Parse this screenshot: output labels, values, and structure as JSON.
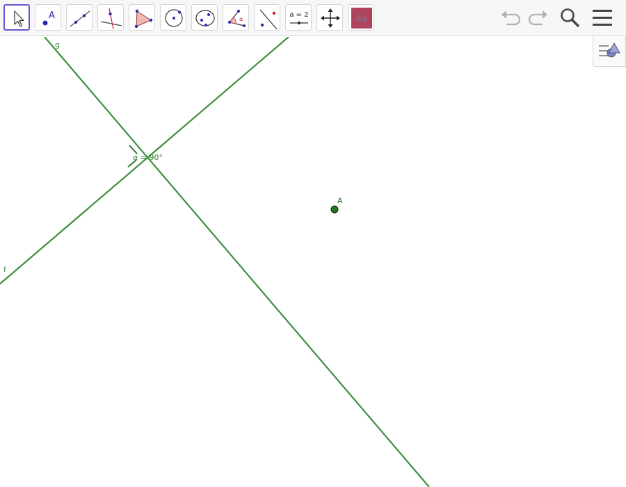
{
  "toolbar": {
    "tools": [
      {
        "name": "move-tool"
      },
      {
        "name": "point-tool",
        "label": "A"
      },
      {
        "name": "line-tool"
      },
      {
        "name": "perpendicular-line-tool"
      },
      {
        "name": "polygon-tool"
      },
      {
        "name": "circle-tool"
      },
      {
        "name": "conic-tool"
      },
      {
        "name": "angle-tool",
        "label": "α"
      },
      {
        "name": "reflect-tool"
      },
      {
        "name": "slider-tool",
        "label": "a = 2"
      },
      {
        "name": "move-graphics-view-tool"
      },
      {
        "name": "custom-tool",
        "label": "Sα"
      }
    ],
    "selected_tool": "move-tool",
    "accent_color": "#6557d2"
  },
  "graphics": {
    "objects": {
      "line_g": {
        "label": "g",
        "color": "#3e8f3e"
      },
      "line_f": {
        "label": "f",
        "color": "#3e8f3e"
      },
      "angle": {
        "label": "α = 90°",
        "color": "#2f7a2f"
      },
      "point_a": {
        "label": "A",
        "color": "#1f7a1f"
      }
    }
  },
  "icons": {
    "undo": "undo-icon",
    "redo": "redo-icon",
    "search": "search-icon",
    "menu": "hamburger-menu-icon",
    "sidebar_toggle": "algebra-view-toggle-icon"
  }
}
